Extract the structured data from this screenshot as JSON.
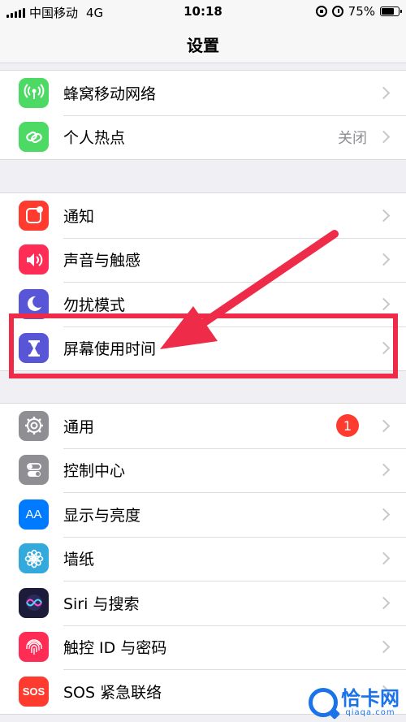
{
  "status_bar": {
    "carrier": "中国移动",
    "network": "4G",
    "time": "10:18",
    "battery": "75%",
    "battery_level": 0.75
  },
  "nav": {
    "title": "设置"
  },
  "colors": {
    "annotation": "#ee2b48",
    "cellular": "#4cd964",
    "hotspot": "#4cd964",
    "notifications": "#ff3b30",
    "sounds": "#ff2d55",
    "dnd": "#5856d6",
    "screen_time": "#5856d6",
    "general": "#8e8e93",
    "control_center": "#8e8e93",
    "display": "#007aff",
    "wallpaper": "#34aadc",
    "siri": "#1c1c3a",
    "touch_id": "#ff2d55",
    "sos": "#ff3b30"
  },
  "groups": {
    "connectivity": [
      {
        "label": "蜂窝移动网络",
        "icon": "antenna-icon",
        "value": ""
      },
      {
        "label": "个人热点",
        "icon": "hotspot-link-icon",
        "value": "关闭"
      }
    ],
    "attention": [
      {
        "label": "通知",
        "icon": "notification-icon"
      },
      {
        "label": "声音与触感",
        "icon": "speaker-icon"
      },
      {
        "label": "勿扰模式",
        "icon": "moon-icon"
      },
      {
        "label": "屏幕使用时间",
        "icon": "hourglass-icon"
      }
    ],
    "system": [
      {
        "label": "通用",
        "icon": "gear-icon",
        "badge": "1"
      },
      {
        "label": "控制中心",
        "icon": "toggles-icon"
      },
      {
        "label": "显示与亮度",
        "icon": "text-size-icon",
        "icon_text": "AA"
      },
      {
        "label": "墙纸",
        "icon": "flower-icon"
      },
      {
        "label": "Siri 与搜索",
        "icon": "siri-icon"
      },
      {
        "label": "触控 ID 与密码",
        "icon": "fingerprint-icon"
      },
      {
        "label": "SOS 紧急联络",
        "icon": "sos-icon",
        "icon_text": "SOS"
      }
    ]
  },
  "watermark": {
    "main": "恰卡网",
    "sub": "qiaqa.com"
  }
}
